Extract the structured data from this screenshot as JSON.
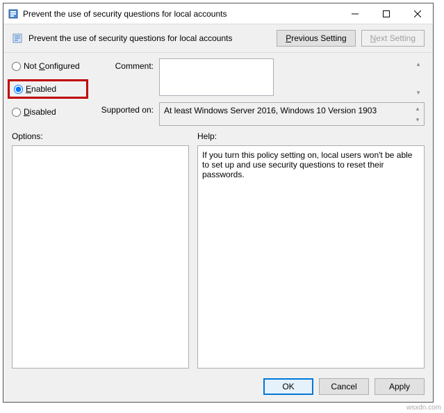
{
  "window": {
    "title": "Prevent the use of security questions for local accounts"
  },
  "toolbar": {
    "title": "Prevent the use of security questions for local accounts",
    "previous_setting": "Previous Setting",
    "next_setting": "Next Setting"
  },
  "radios": {
    "not_configured": "Not Configured",
    "enabled": "Enabled",
    "disabled": "Disabled",
    "selected": "enabled"
  },
  "fields": {
    "comment_label": "Comment:",
    "comment_value": "",
    "supported_label": "Supported on:",
    "supported_value": "At least Windows Server 2016, Windows 10 Version 1903"
  },
  "panels": {
    "options_label": "Options:",
    "help_label": "Help:",
    "help_text": "If you turn this policy setting on, local users won't be able to set up and use security questions to reset their passwords."
  },
  "buttons": {
    "ok": "OK",
    "cancel": "Cancel",
    "apply": "Apply"
  },
  "watermark": "wsxdn.com"
}
